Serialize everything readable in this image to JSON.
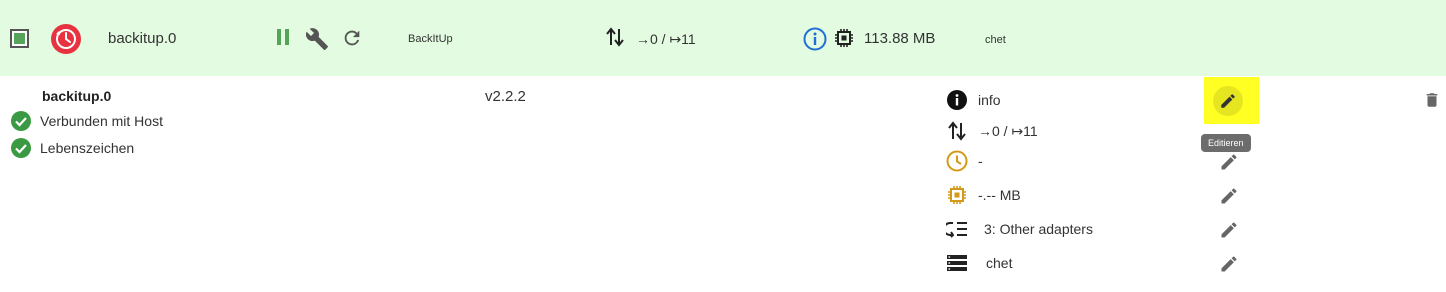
{
  "header": {
    "instance_name": "backitup.0",
    "adapter_title": "BackItUp",
    "events": "→0 / ↦11",
    "memory": "113.88 MB",
    "host": "chet",
    "enabled": true
  },
  "details": {
    "instance_name": "backitup.0",
    "status": [
      {
        "label": "Verbunden mit Host"
      },
      {
        "label": "Lebenszeichen"
      }
    ],
    "version": "v2.2.2"
  },
  "properties": [
    {
      "icon": "info-icon",
      "value": "info"
    },
    {
      "icon": "events-icon",
      "value": "→0 / ↦11"
    },
    {
      "icon": "clock-icon",
      "value": "-"
    },
    {
      "icon": "chip-icon",
      "value": "-.-- MB"
    },
    {
      "icon": "tier-icon",
      "value": "3: Other adapters"
    },
    {
      "icon": "host-icon",
      "value": "chet"
    }
  ],
  "tooltip": "Editieren",
  "colors": {
    "row_bg": "#e3fbe0",
    "accent_green": "#56a35a",
    "logo_red": "#e8323f",
    "info_blue": "#1f6fd6",
    "warn_orange": "#d39a1a",
    "highlight_yellow": "#ffff24"
  }
}
